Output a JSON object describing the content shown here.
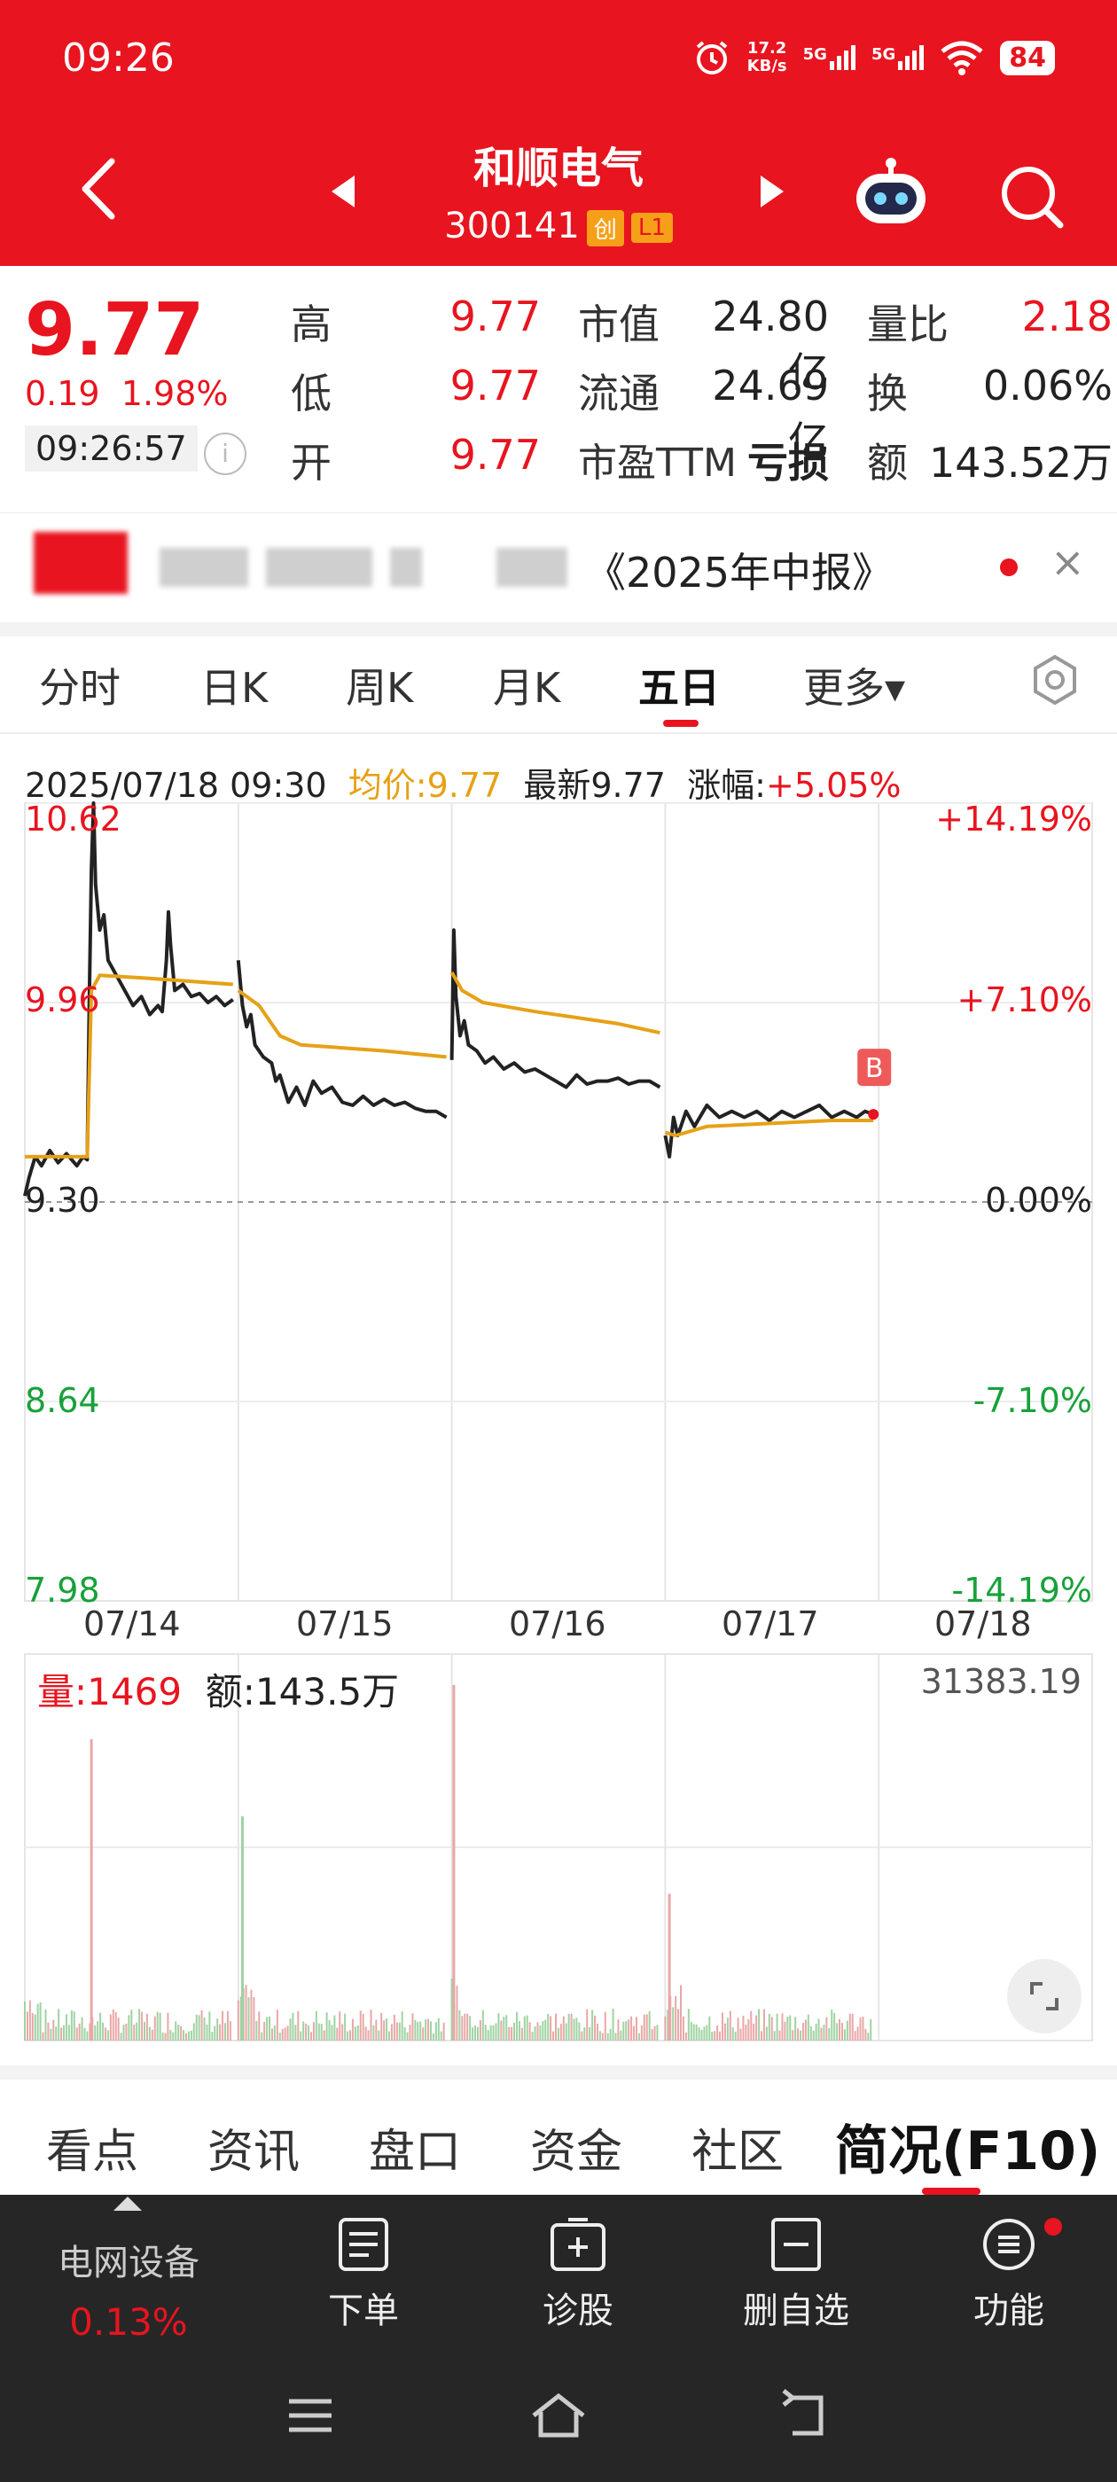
{
  "status_bar": {
    "time": "09:26",
    "net_speed_value": "17.2",
    "net_speed_unit": "KB/s",
    "signal1": "5G",
    "signal2": "5G",
    "battery": "84"
  },
  "header": {
    "stock_name": "和顺电气",
    "stock_code": "300141",
    "tag1": "创",
    "tag2": "L1",
    "icons": [
      "back-chevron-icon",
      "prev-stock-icon",
      "next-stock-icon",
      "robot-assistant-icon",
      "search-icon"
    ]
  },
  "quote": {
    "price": "9.77",
    "change": "0.19",
    "change_pct": "1.98%",
    "time": "09:26:57",
    "high_label": "高",
    "high": "9.77",
    "low_label": "低",
    "low": "9.77",
    "open_label": "开",
    "open": "9.77",
    "mktcap_label": "市值",
    "mktcap": "24.80亿",
    "float_label": "流通",
    "float": "24.69亿",
    "pe_label": "市盈TTM",
    "pe": "亏损",
    "vol_ratio_label": "量比",
    "vol_ratio": "2.18",
    "turnover_label": "换",
    "turnover": "0.06%",
    "amount_label": "额",
    "amount": "143.52万",
    "colors": {
      "up": "#e8141f",
      "down": "#18a13a",
      "avg": "#e6a116"
    }
  },
  "news": {
    "text": "《2025年中报》",
    "close": "×"
  },
  "period_tabs": [
    "分时",
    "日K",
    "周K",
    "月K",
    "五日",
    "更多▾"
  ],
  "active_period": "五日",
  "chart_info": {
    "datetime": "2025/07/18 09:30",
    "avg_label": "均价:9.77",
    "latest_label": "最新9.77",
    "change_label": "涨幅:",
    "change_value": "+5.05%"
  },
  "chart_data": {
    "type": "line",
    "title": "",
    "x_days": [
      "07/14",
      "07/15",
      "07/16",
      "07/17",
      "07/18"
    ],
    "y_ticks": [
      "10.62",
      "9.96",
      "9.30",
      "8.64",
      "7.98"
    ],
    "pct_ticks": [
      "+14.19%",
      "+7.10%",
      "0.00%",
      "-7.10%",
      "-14.19%"
    ],
    "ylim": [
      7.98,
      10.62
    ],
    "prev_close": 9.3,
    "series": [
      {
        "name": "最新",
        "days": [
          {
            "day": "07/14",
            "points": [
              [
                0.0,
                9.32
              ],
              [
                0.02,
                9.38
              ],
              [
                0.05,
                9.45
              ],
              [
                0.08,
                9.42
              ],
              [
                0.12,
                9.47
              ],
              [
                0.16,
                9.43
              ],
              [
                0.2,
                9.46
              ],
              [
                0.25,
                9.42
              ],
              [
                0.28,
                9.45
              ],
              [
                0.3,
                9.44
              ],
              [
                0.31,
                9.98
              ],
              [
                0.32,
                10.4
              ],
              [
                0.33,
                10.62
              ],
              [
                0.34,
                10.35
              ],
              [
                0.36,
                10.2
              ],
              [
                0.38,
                10.25
              ],
              [
                0.4,
                10.1
              ],
              [
                0.44,
                10.05
              ],
              [
                0.48,
                10.0
              ],
              [
                0.52,
                9.95
              ],
              [
                0.56,
                9.98
              ],
              [
                0.6,
                9.92
              ],
              [
                0.64,
                9.95
              ],
              [
                0.66,
                9.93
              ],
              [
                0.68,
                10.1
              ],
              [
                0.69,
                10.26
              ],
              [
                0.7,
                10.15
              ],
              [
                0.72,
                10.0
              ],
              [
                0.76,
                10.02
              ],
              [
                0.8,
                9.98
              ],
              [
                0.84,
                9.99
              ],
              [
                0.88,
                9.96
              ],
              [
                0.92,
                9.98
              ],
              [
                0.96,
                9.95
              ],
              [
                1.0,
                9.97
              ]
            ]
          },
          {
            "day": "07/15",
            "points": [
              [
                0.0,
                10.1
              ],
              [
                0.02,
                9.95
              ],
              [
                0.04,
                9.88
              ],
              [
                0.06,
                9.92
              ],
              [
                0.08,
                9.82
              ],
              [
                0.12,
                9.78
              ],
              [
                0.16,
                9.76
              ],
              [
                0.18,
                9.7
              ],
              [
                0.2,
                9.72
              ],
              [
                0.24,
                9.63
              ],
              [
                0.28,
                9.68
              ],
              [
                0.32,
                9.62
              ],
              [
                0.36,
                9.7
              ],
              [
                0.4,
                9.66
              ],
              [
                0.45,
                9.68
              ],
              [
                0.5,
                9.63
              ],
              [
                0.55,
                9.62
              ],
              [
                0.6,
                9.65
              ],
              [
                0.65,
                9.62
              ],
              [
                0.7,
                9.64
              ],
              [
                0.75,
                9.62
              ],
              [
                0.8,
                9.63
              ],
              [
                0.85,
                9.61
              ],
              [
                0.9,
                9.6
              ],
              [
                0.95,
                9.6
              ],
              [
                1.0,
                9.58
              ]
            ]
          },
          {
            "day": "07/16",
            "points": [
              [
                0.0,
                9.77
              ],
              [
                0.01,
                10.2
              ],
              [
                0.02,
                9.98
              ],
              [
                0.04,
                9.85
              ],
              [
                0.06,
                9.9
              ],
              [
                0.08,
                9.82
              ],
              [
                0.12,
                9.8
              ],
              [
                0.16,
                9.76
              ],
              [
                0.2,
                9.78
              ],
              [
                0.25,
                9.74
              ],
              [
                0.3,
                9.76
              ],
              [
                0.35,
                9.73
              ],
              [
                0.4,
                9.74
              ],
              [
                0.45,
                9.72
              ],
              [
                0.5,
                9.7
              ],
              [
                0.55,
                9.68
              ],
              [
                0.6,
                9.72
              ],
              [
                0.65,
                9.69
              ],
              [
                0.7,
                9.7
              ],
              [
                0.75,
                9.7
              ],
              [
                0.8,
                9.71
              ],
              [
                0.85,
                9.69
              ],
              [
                0.9,
                9.7
              ],
              [
                0.95,
                9.7
              ],
              [
                1.0,
                9.68
              ]
            ]
          },
          {
            "day": "07/17",
            "points": [
              [
                0.0,
                9.52
              ],
              [
                0.02,
                9.45
              ],
              [
                0.04,
                9.58
              ],
              [
                0.06,
                9.52
              ],
              [
                0.1,
                9.6
              ],
              [
                0.14,
                9.55
              ],
              [
                0.2,
                9.62
              ],
              [
                0.26,
                9.58
              ],
              [
                0.32,
                9.6
              ],
              [
                0.38,
                9.58
              ],
              [
                0.44,
                9.6
              ],
              [
                0.5,
                9.57
              ],
              [
                0.56,
                9.6
              ],
              [
                0.62,
                9.58
              ],
              [
                0.68,
                9.6
              ],
              [
                0.74,
                9.62
              ],
              [
                0.8,
                9.58
              ],
              [
                0.86,
                9.6
              ],
              [
                0.92,
                9.58
              ],
              [
                0.96,
                9.6
              ],
              [
                1.0,
                9.59
              ]
            ]
          },
          {
            "day": "07/18",
            "points": []
          }
        ]
      },
      {
        "name": "均价",
        "days": [
          {
            "day": "07/14",
            "points": [
              [
                0.0,
                9.45
              ],
              [
                0.3,
                9.45
              ],
              [
                0.32,
                10.0
              ],
              [
                0.36,
                10.05
              ],
              [
                0.6,
                10.04
              ],
              [
                1.0,
                10.02
              ]
            ]
          },
          {
            "day": "07/15",
            "points": [
              [
                0.0,
                10.0
              ],
              [
                0.1,
                9.95
              ],
              [
                0.2,
                9.85
              ],
              [
                0.3,
                9.82
              ],
              [
                0.5,
                9.81
              ],
              [
                0.7,
                9.8
              ],
              [
                1.0,
                9.78
              ]
            ]
          },
          {
            "day": "07/16",
            "points": [
              [
                0.0,
                10.06
              ],
              [
                0.05,
                10.0
              ],
              [
                0.15,
                9.96
              ],
              [
                0.4,
                9.93
              ],
              [
                0.6,
                9.91
              ],
              [
                0.8,
                9.89
              ],
              [
                1.0,
                9.86
              ]
            ]
          },
          {
            "day": "07/17",
            "points": [
              [
                0.0,
                9.53
              ],
              [
                0.05,
                9.52
              ],
              [
                0.2,
                9.55
              ],
              [
                0.5,
                9.56
              ],
              [
                0.8,
                9.57
              ],
              [
                1.0,
                9.57
              ]
            ]
          },
          {
            "day": "07/18",
            "points": []
          }
        ]
      }
    ],
    "marker": {
      "label": "B",
      "day": "07/17",
      "pos": 1.0,
      "value": 9.59
    },
    "grid": true,
    "legend": "none"
  },
  "volume": {
    "vol_label": "量:",
    "vol_value": "1469",
    "amount_label": "额:143.5万",
    "max_label": "31383.19"
  },
  "bottom_tabs": [
    "看点",
    "资讯",
    "盘口",
    "资金",
    "社区",
    "简况(F10)"
  ],
  "active_bottom_tab": "简况(F10)",
  "bottom_bar": {
    "sector_name": "电网设备",
    "sector_pct": "0.13%",
    "items": [
      {
        "label": "下单",
        "icon": "order-doc-icon"
      },
      {
        "label": "诊股",
        "icon": "diagnose-icon"
      },
      {
        "label": "删自选",
        "icon": "remove-watchlist-icon"
      },
      {
        "label": "功能",
        "icon": "function-menu-icon"
      }
    ]
  }
}
